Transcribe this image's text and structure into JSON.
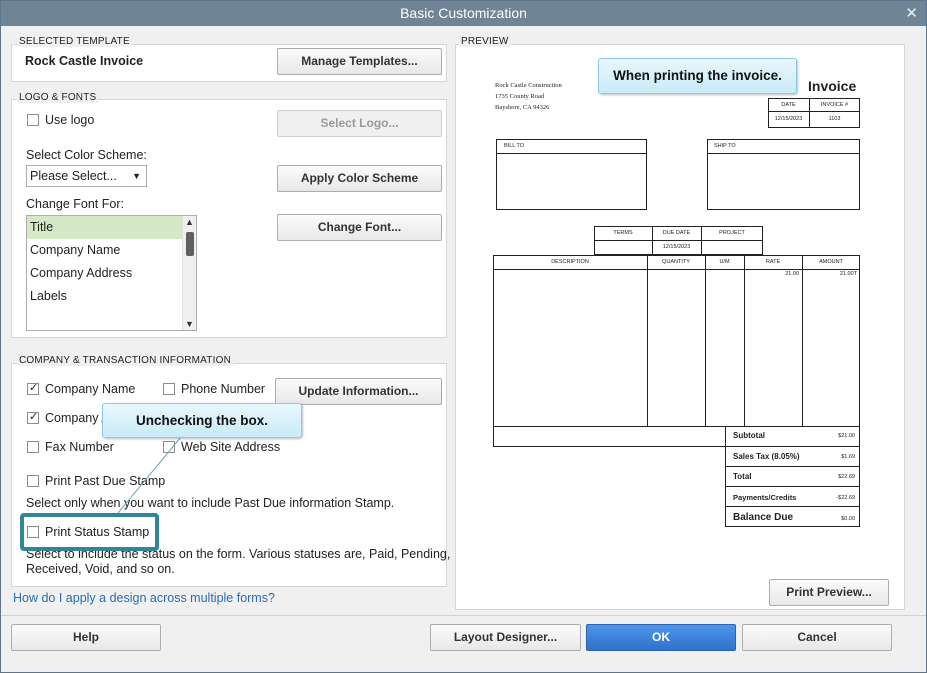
{
  "window": {
    "title": "Basic Customization",
    "close_glyph": "✕"
  },
  "selected_template": {
    "heading": "SELECTED TEMPLATE",
    "name": "Rock Castle Invoice",
    "manage_button": "Manage Templates..."
  },
  "logo_fonts": {
    "heading": "LOGO & FONTS",
    "use_logo_label": "Use logo",
    "use_logo_checked": false,
    "select_logo_button": "Select Logo...",
    "color_scheme_label": "Select Color Scheme:",
    "color_scheme_value": "Please Select...",
    "apply_color_button": "Apply Color Scheme",
    "change_font_label": "Change Font For:",
    "font_items": [
      "Title",
      "Company Name",
      "Company Address",
      "Labels"
    ],
    "selected_font_item": "Title",
    "change_font_button": "Change Font..."
  },
  "company_info": {
    "heading": "COMPANY & TRANSACTION INFORMATION",
    "company_name_label": "Company Name",
    "company_name_checked": true,
    "phone_label": "Phone Number",
    "phone_checked": false,
    "update_button": "Update Information...",
    "company_address_label": "Company A",
    "company_address_checked": true,
    "fax_label": "Fax Number",
    "fax_checked": false,
    "website_label": "Web Site Address",
    "website_checked": false,
    "past_due_label": "Print Past Due Stamp",
    "past_due_checked": false,
    "past_due_help": "Select only when you want to include Past Due information Stamp.",
    "status_stamp_label": "Print Status Stamp",
    "status_stamp_checked": false,
    "status_help_line1": "Select to include the status on the form. Various statuses are, Paid, Pending,",
    "status_help_line2": "Received, Void, and so on."
  },
  "help_link": "How do I apply a design across multiple forms?",
  "preview": {
    "heading": "PREVIEW",
    "company_lines": [
      "Rock Castle Construction",
      "1735 County Road",
      "Bayshore, CA 94326"
    ],
    "title": "Invoice",
    "date_label": "DATE",
    "invoice_no_label": "INVOICE #",
    "date_value": "12/15/2023",
    "invoice_no_value": "1103",
    "bill_to": "BILL TO",
    "ship_to": "SHIP TO",
    "terms_label": "TERMS",
    "due_date_label": "DUE DATE",
    "project_label": "PROJECT",
    "due_date_value": "12/15/2023",
    "columns": [
      "DESCRIPTION",
      "QUANTITY",
      "U/M",
      "RATE",
      "AMOUNT"
    ],
    "rate_value": "21.00",
    "amount_value": "21.00T",
    "subtotal_label": "Subtotal",
    "subtotal_value": "$21.00",
    "tax_label": "Sales Tax  (8.05%)",
    "tax_value": "$1.69",
    "total_label": "Total",
    "total_value": "$22.69",
    "payments_label": "Payments/Credits",
    "payments_value": "-$22.69",
    "balance_label": "Balance Due",
    "balance_value": "$0.00",
    "print_preview_button": "Print Preview..."
  },
  "callouts": {
    "printing": "When printing the invoice.",
    "unchecking": "Unchecking the box."
  },
  "footer": {
    "help": "Help",
    "layout_designer": "Layout Designer...",
    "ok": "OK",
    "cancel": "Cancel"
  }
}
